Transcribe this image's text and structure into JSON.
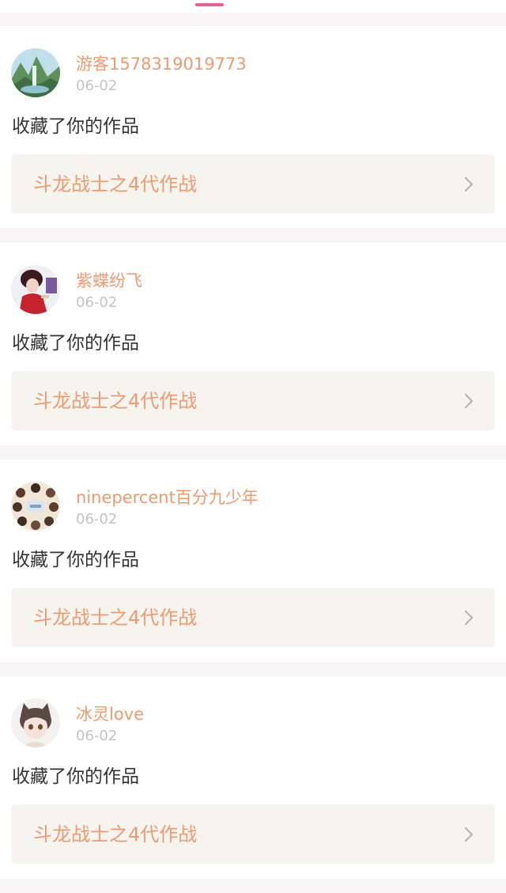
{
  "notifications": [
    {
      "username": "游客1578319019773",
      "date": "06-02",
      "action": "收藏了你的作品",
      "work_title": "斗龙战士之4代作战",
      "avatar": "landscape-avatar"
    },
    {
      "username": "紫蝶纷飞",
      "date": "06-02",
      "action": "收藏了你的作品",
      "work_title": "斗龙战士之4代作战",
      "avatar": "girl-in-red-avatar"
    },
    {
      "username": "ninepercent百分九少年",
      "date": "06-02",
      "action": "收藏了你的作品",
      "work_title": "斗龙战士之4代作战",
      "avatar": "group-collage-avatar"
    },
    {
      "username": "冰灵love",
      "date": "06-02",
      "action": "收藏了你的作品",
      "work_title": "斗龙战士之4代作战",
      "avatar": "anime-cat-ears-avatar"
    }
  ],
  "colors": {
    "accent_pink": "#f05b9a",
    "name_orange": "#ee9a6e",
    "date_gray": "#c3c3c3",
    "link_background": "#f5f4ee"
  }
}
